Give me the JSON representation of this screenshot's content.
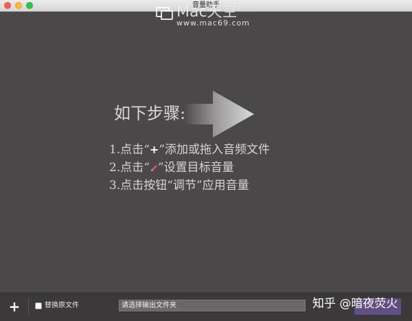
{
  "window": {
    "title": "音量助手"
  },
  "watermark": {
    "main": "Mac天空",
    "sub": "www.mac69.com"
  },
  "instructions": {
    "heading": "如下步骤:",
    "step1_prefix": "1.点击“",
    "step1_icon": "+",
    "step1_suffix": "”添加或拖入音频文件",
    "step2_prefix": "2.点击“",
    "step2_suffix": "”设置目标音量",
    "step3": "3.点击按钮“调节”应用音量"
  },
  "bottombar": {
    "add_label": "+",
    "replace_checkbox_label": "替换原文件",
    "replace_checked": false,
    "output_placeholder": "请选择输出文件夹"
  },
  "overlay": {
    "zhihu": "知乎 @暗夜荧火"
  },
  "colors": {
    "background": "#4b4849",
    "bottombar": "#3c393a",
    "accent_button": "#5f4f86",
    "pen_icon": "#d9534f"
  }
}
